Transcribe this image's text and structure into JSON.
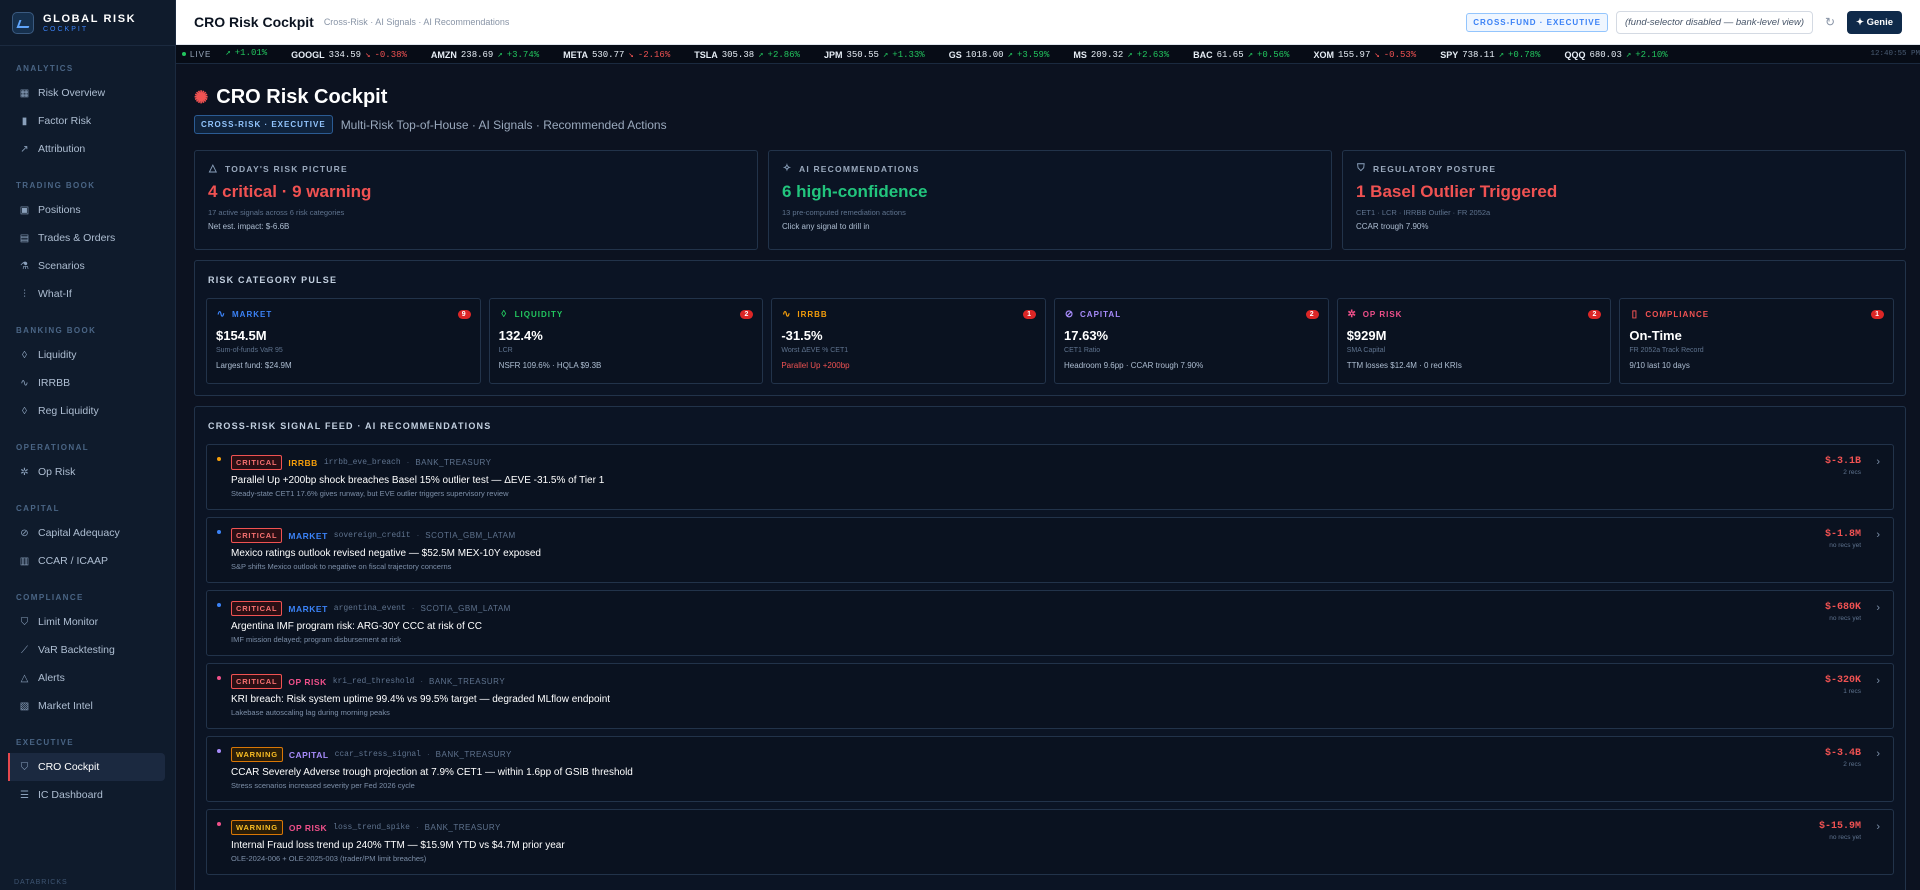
{
  "brand": {
    "title": "GLOBAL RISK",
    "subtitle": "COCKPIT"
  },
  "sidebar": {
    "sections": [
      {
        "label": "ANALYTICS",
        "items": [
          {
            "label": "Risk Overview",
            "icon": "grid-icon"
          },
          {
            "label": "Factor Risk",
            "icon": "bar-chart-icon"
          },
          {
            "label": "Attribution",
            "icon": "trend-icon"
          }
        ]
      },
      {
        "label": "TRADING BOOK",
        "items": [
          {
            "label": "Positions",
            "icon": "briefcase-icon"
          },
          {
            "label": "Trades & Orders",
            "icon": "receipt-icon"
          },
          {
            "label": "Scenarios",
            "icon": "flask-icon"
          },
          {
            "label": "What-If",
            "icon": "sliders-icon"
          }
        ]
      },
      {
        "label": "BANKING BOOK",
        "items": [
          {
            "label": "Liquidity",
            "icon": "droplet-icon"
          },
          {
            "label": "IRRBB",
            "icon": "activity-icon"
          },
          {
            "label": "Reg Liquidity",
            "icon": "drops-icon"
          }
        ]
      },
      {
        "label": "OPERATIONAL",
        "items": [
          {
            "label": "Op Risk",
            "icon": "bug-icon"
          }
        ]
      },
      {
        "label": "CAPITAL",
        "items": [
          {
            "label": "Capital Adequacy",
            "icon": "link-icon"
          },
          {
            "label": "CCAR / ICAAP",
            "icon": "calendar-icon"
          }
        ]
      },
      {
        "label": "COMPLIANCE",
        "items": [
          {
            "label": "Limit Monitor",
            "icon": "shield-icon"
          },
          {
            "label": "VaR Backtesting",
            "icon": "line-chart-icon"
          },
          {
            "label": "Alerts",
            "icon": "warning-icon"
          },
          {
            "label": "Market Intel",
            "icon": "news-icon"
          }
        ]
      },
      {
        "label": "EXECUTIVE",
        "items": [
          {
            "label": "CRO Cockpit",
            "icon": "shield-check-icon",
            "active": true
          },
          {
            "label": "IC Dashboard",
            "icon": "database-icon"
          }
        ]
      }
    ],
    "footer": "DATABRICKS"
  },
  "topbar": {
    "title": "CRO Risk Cockpit",
    "crumb": "Cross-Risk · AI Signals · AI Recommendations",
    "badge": "CROSS-FUND · EXECUTIVE",
    "fund_selector": "(fund-selector disabled — bank-level view)",
    "genie": "Genie"
  },
  "ticker": {
    "live": "LIVE",
    "clock": "12:40:55 PM",
    "items": [
      {
        "sym": "",
        "price": "",
        "chg": "+1.01%",
        "dir": "up"
      },
      {
        "sym": "GOOGL",
        "price": "334.59",
        "chg": "-0.38%",
        "dir": "dn"
      },
      {
        "sym": "AMZN",
        "price": "238.69",
        "chg": "+3.74%",
        "dir": "up"
      },
      {
        "sym": "META",
        "price": "530.77",
        "chg": "-2.16%",
        "dir": "dn"
      },
      {
        "sym": "TSLA",
        "price": "305.38",
        "chg": "+2.86%",
        "dir": "up"
      },
      {
        "sym": "JPM",
        "price": "350.55",
        "chg": "+1.33%",
        "dir": "up"
      },
      {
        "sym": "GS",
        "price": "1018.00",
        "chg": "+3.59%",
        "dir": "up"
      },
      {
        "sym": "MS",
        "price": "209.32",
        "chg": "+2.63%",
        "dir": "up"
      },
      {
        "sym": "BAC",
        "price": "61.65",
        "chg": "+0.56%",
        "dir": "up"
      },
      {
        "sym": "XOM",
        "price": "155.97",
        "chg": "-0.53%",
        "dir": "dn"
      },
      {
        "sym": "SPY",
        "price": "738.11",
        "chg": "+0.78%",
        "dir": "up"
      },
      {
        "sym": "QQQ",
        "price": "680.03",
        "chg": "+2.10%",
        "dir": "up"
      }
    ]
  },
  "page": {
    "title": "CRO Risk Cockpit",
    "tag": "CROSS-RISK · EXECUTIVE",
    "subtitle": "Multi-Risk Top-of-House · AI Signals · Recommended Actions"
  },
  "summary": [
    {
      "header": "TODAY'S RISK PICTURE",
      "icon": "warning-icon",
      "big": "4 critical · 9 warning",
      "color": "red",
      "sub": "17 active signals across 6 risk categories",
      "sub2": "Net est. impact: $-6.6B"
    },
    {
      "header": "AI RECOMMENDATIONS",
      "icon": "sparkle-icon",
      "big": "6 high-confidence",
      "color": "green",
      "sub": "13 pre-computed remediation actions",
      "sub2": "Click any signal to drill in"
    },
    {
      "header": "REGULATORY POSTURE",
      "icon": "shield-icon",
      "big": "1 Basel Outlier Triggered",
      "color": "red",
      "sub": "CET1 · LCR · IRRBB Outlier · FR 2052a",
      "sub2": "CCAR trough 7.90%"
    }
  ],
  "pulse": {
    "title": "RISK CATEGORY PULSE",
    "items": [
      {
        "label": "MARKET",
        "color": "#3b82f6",
        "icon": "activity-icon",
        "count": "9",
        "value": "$154.5M",
        "metric": "Sum-of-funds VaR 95",
        "note": "Largest fund: $24.9M",
        "alert": false
      },
      {
        "label": "LIQUIDITY",
        "color": "#22c55e",
        "icon": "droplet-icon",
        "count": "2",
        "value": "132.4%",
        "metric": "LCR",
        "note": "NSFR 109.6% · HQLA $9.3B",
        "alert": false
      },
      {
        "label": "IRRBB",
        "color": "#f59e0b",
        "icon": "activity-icon",
        "count": "1",
        "value": "-31.5%",
        "metric": "Worst ΔEVE % CET1",
        "note": "Parallel Up +200bp",
        "alert": true
      },
      {
        "label": "CAPITAL",
        "color": "#a78bfa",
        "icon": "link-icon",
        "count": "2",
        "value": "17.63%",
        "metric": "CET1 Ratio",
        "note": "Headroom 9.6pp · CCAR trough 7.90%",
        "alert": false
      },
      {
        "label": "OP RISK",
        "color": "#f0508a",
        "icon": "bug-icon",
        "count": "2",
        "value": "$929M",
        "metric": "SMA Capital",
        "note": "TTM losses $12.4M · 0 red KRIs",
        "alert": false
      },
      {
        "label": "COMPLIANCE",
        "color": "#f05252",
        "icon": "clipboard-icon",
        "count": "1",
        "value": "On-Time",
        "metric": "FR 2052a Track Record",
        "note": "9/10 last 10 days",
        "alert": false
      }
    ]
  },
  "feed": {
    "title": "CROSS-RISK SIGNAL FEED · AI RECOMMENDATIONS",
    "signals": [
      {
        "sev": "CRITICAL",
        "sevc": "crit",
        "cat": "IRRBB",
        "catc": "#f59e0b",
        "dot": "#f59e0b",
        "code": "irrbb_eve_breach",
        "owner": "BANK_TREASURY",
        "title": "Parallel Up +200bp shock breaches Basel 15% outlier test — ΔEVE -31.5% of Tier 1",
        "sub": "Steady-state CET1 17.6% gives runway, but EVE outlier triggers supervisory review",
        "amt": "$-3.1B",
        "recs": "2 recs"
      },
      {
        "sev": "CRITICAL",
        "sevc": "crit",
        "cat": "MARKET",
        "catc": "#3b82f6",
        "dot": "#3b82f6",
        "code": "sovereign_credit",
        "owner": "SCOTIA_GBM_LATAM",
        "title": "Mexico ratings outlook revised negative — $52.5M MEX-10Y exposed",
        "sub": "S&P shifts Mexico outlook to negative on fiscal trajectory concerns",
        "amt": "$-1.8M",
        "recs": "no recs yet"
      },
      {
        "sev": "CRITICAL",
        "sevc": "crit",
        "cat": "MARKET",
        "catc": "#3b82f6",
        "dot": "#3b82f6",
        "code": "argentina_event",
        "owner": "SCOTIA_GBM_LATAM",
        "title": "Argentina IMF program risk: ARG-30Y CCC at risk of CC",
        "sub": "IMF mission delayed; program disbursement at risk",
        "amt": "$-680K",
        "recs": "no recs yet"
      },
      {
        "sev": "CRITICAL",
        "sevc": "crit",
        "cat": "OP RISK",
        "catc": "#f0508a",
        "dot": "#f0508a",
        "code": "kri_red_threshold",
        "owner": "BANK_TREASURY",
        "title": "KRI breach: Risk system uptime 99.4% vs 99.5% target — degraded MLflow endpoint",
        "sub": "Lakebase autoscaling lag during morning peaks",
        "amt": "$-320K",
        "recs": "1 recs"
      },
      {
        "sev": "WARNING",
        "sevc": "warn",
        "cat": "CAPITAL",
        "catc": "#a78bfa",
        "dot": "#a78bfa",
        "code": "ccar_stress_signal",
        "owner": "BANK_TREASURY",
        "title": "CCAR Severely Adverse trough projection at 7.9% CET1 — within 1.6pp of GSIB threshold",
        "sub": "Stress scenarios increased severity per Fed 2026 cycle",
        "amt": "$-3.4B",
        "recs": "2 recs"
      },
      {
        "sev": "WARNING",
        "sevc": "warn",
        "cat": "OP RISK",
        "catc": "#f0508a",
        "dot": "#f0508a",
        "code": "loss_trend_spike",
        "owner": "BANK_TREASURY",
        "title": "Internal Fraud loss trend up 240% TTM — $15.9M YTD vs $4.7M prior year",
        "sub": "OLE-2024-006 + OLE-2025-003 (trader/PM limit breaches)",
        "amt": "$-15.9M",
        "recs": "no recs yet"
      }
    ]
  }
}
